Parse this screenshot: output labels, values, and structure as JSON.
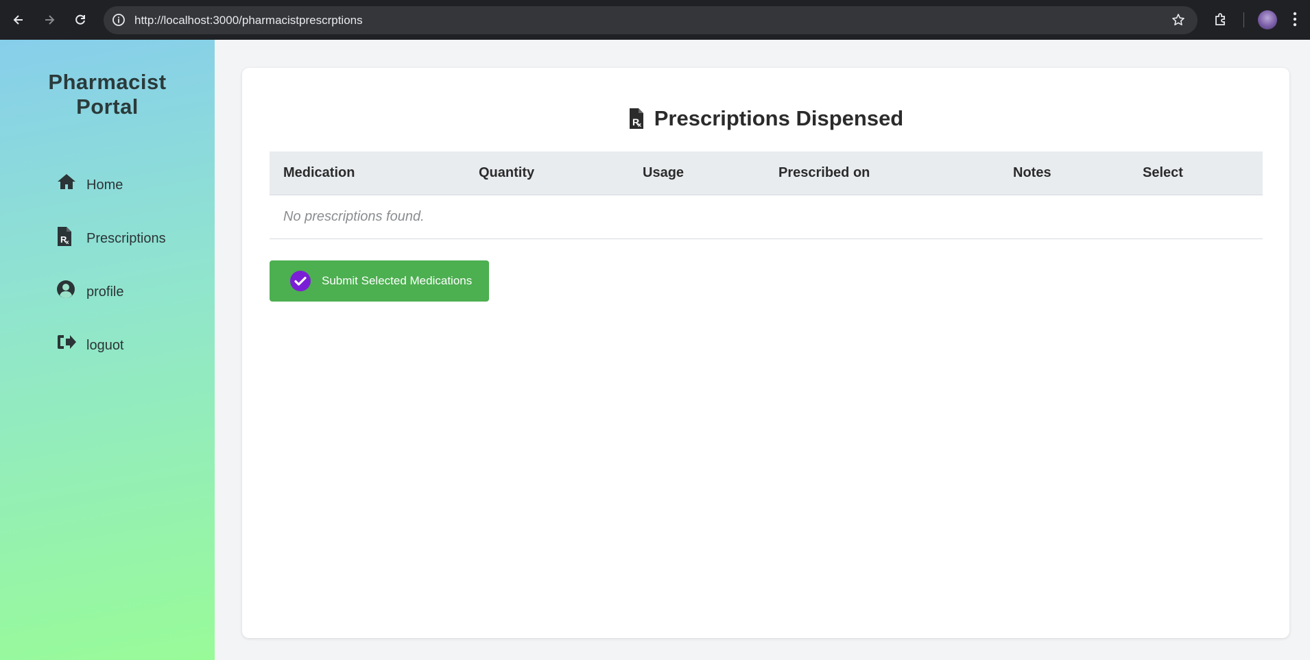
{
  "browser": {
    "url": "http://localhost:3000/pharmacistprescrptions"
  },
  "sidebar": {
    "brand": "Pharmacist Portal",
    "items": [
      {
        "label": "Home",
        "icon": "home-icon"
      },
      {
        "label": "Prescriptions",
        "icon": "prescription-file-icon"
      },
      {
        "label": "profile",
        "icon": "user-circle-icon"
      },
      {
        "label": "loguot",
        "icon": "sign-out-icon"
      }
    ]
  },
  "main": {
    "title": "Prescriptions Dispensed",
    "title_icon": "prescription-file-icon",
    "table": {
      "columns": [
        "Medication",
        "Quantity",
        "Usage",
        "Prescribed on",
        "Notes",
        "Select"
      ],
      "empty_message": "No prescriptions found."
    },
    "submit_label": "Submit Selected Medications",
    "submit_icon": "check-circle-icon"
  },
  "colors": {
    "chrome_bg": "#202124",
    "sidebar_gradient_start": "#87ceeb",
    "sidebar_gradient_end": "#98fb98",
    "submit_button": "#4caf50",
    "check_icon": "#7b1fd6",
    "table_header_bg": "#e9ecef"
  }
}
